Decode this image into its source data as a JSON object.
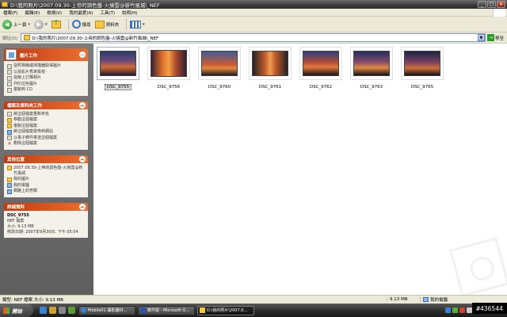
{
  "window": {
    "title": "D:\\我的照片\\2007.09.30-上帝的調色盤-火燒雲@新竹風城\\_NEF",
    "buttons": [
      "_",
      "□",
      "✕"
    ]
  },
  "menu": [
    "檔案(F)",
    "編輯(E)",
    "檢視(V)",
    "我的最愛(A)",
    "工具(T)",
    "說明(H)"
  ],
  "toolbar": {
    "back_label": "上一頁",
    "search_label": "搜尋",
    "folders_label": "資料夾"
  },
  "address": {
    "label": "網址(D)",
    "path": "D:\\我的照片\\2007.09.30-上帝的調色盤-火燒雲@新竹風城\\_NEF",
    "go_label": "移至"
  },
  "left_pane": {
    "picture_tasks": {
      "title": "圖片工作",
      "items": [
        "從照相機或掃描器取得圖片",
        "以投影片秀來檢視",
        "從線上訂購相片",
        "列印這些圖片",
        "複製到 CD"
      ]
    },
    "file_tasks": {
      "title": "檔案及資料夾工作",
      "items": [
        "將這個檔案重新命名",
        "移動這個檔案",
        "複製這個檔案",
        "將這個檔案發佈到網站",
        "以電子郵件寄送這個檔案",
        "刪除這個檔案"
      ]
    },
    "other_places": {
      "title": "其他位置",
      "items": [
        "2007.09.30-上帝的調色盤-火燒雲@新竹風城",
        "我的圖片",
        "我的電腦",
        "網路上的芳鄰"
      ]
    },
    "details": {
      "title": "詳細資料",
      "name": "DSC_9755",
      "type": "NEF 檔案",
      "size": "大小: 9.13 MB",
      "modified": "修改日期: 2007年9月30日, 下午 05:54"
    }
  },
  "files": [
    {
      "name": "DSC_9755",
      "selected": true
    },
    {
      "name": "DSC_9756",
      "selected": false
    },
    {
      "name": "DSC_9760",
      "selected": false
    },
    {
      "name": "DSC_9761",
      "selected": false
    },
    {
      "name": "DSC_9762",
      "selected": false
    },
    {
      "name": "DSC_9763",
      "selected": false
    },
    {
      "name": "DSC_9765",
      "selected": false
    }
  ],
  "status": {
    "left": "類型: NEF 檔案 大小: 9.13 MB",
    "size": "9.13 MB",
    "zone": "我的電腦"
  },
  "taskbar": {
    "start_label": "開始",
    "tasks": [
      "Mobile01 攝影器材...",
      "軟件屋 - Microsoft O...",
      "D:\\我的照片\\2007.0..."
    ]
  },
  "hex_label": "#436544"
}
